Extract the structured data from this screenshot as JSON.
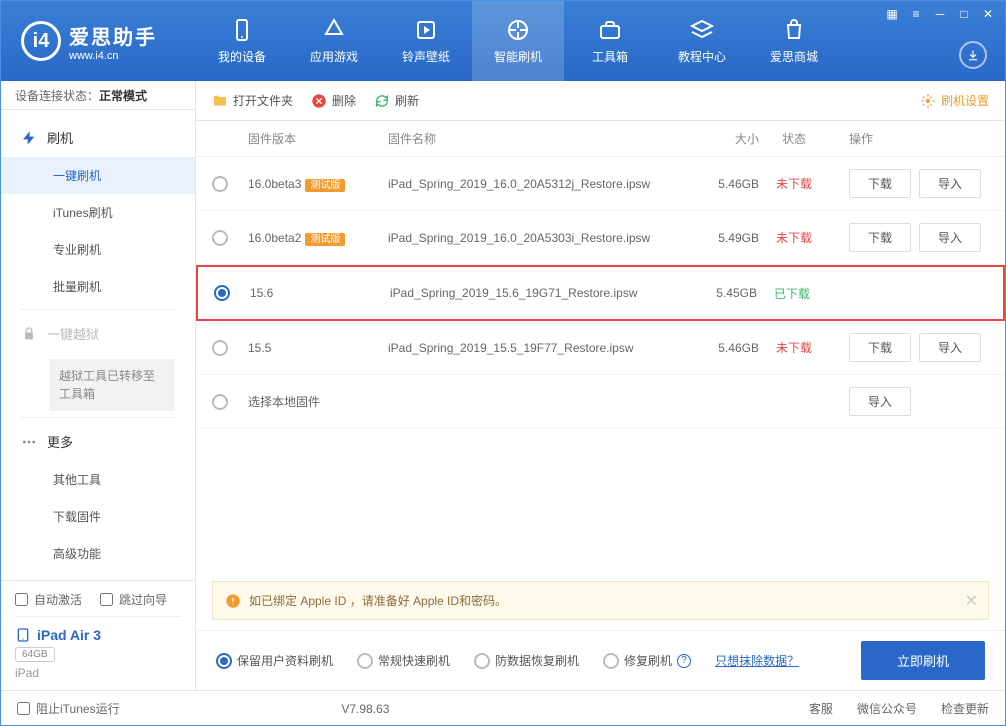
{
  "app": {
    "title": "爱思助手",
    "subtitle": "www.i4.cn"
  },
  "nav": {
    "items": [
      {
        "label": "我的设备"
      },
      {
        "label": "应用游戏"
      },
      {
        "label": "铃声壁纸"
      },
      {
        "label": "智能刷机"
      },
      {
        "label": "工具箱"
      },
      {
        "label": "教程中心"
      },
      {
        "label": "爱思商城"
      }
    ]
  },
  "status": {
    "label": "设备连接状态：",
    "value": "正常模式"
  },
  "sidebar": {
    "flash": {
      "head": "刷机",
      "items": [
        "一键刷机",
        "iTunes刷机",
        "专业刷机",
        "批量刷机"
      ]
    },
    "jailbreak": {
      "head": "一键越狱",
      "note": "越狱工具已转移至工具箱"
    },
    "more": {
      "head": "更多",
      "items": [
        "其他工具",
        "下载固件",
        "高级功能"
      ]
    },
    "auto_activate": "自动激活",
    "skip_guide": "跳过向导",
    "device": {
      "name": "iPad Air 3",
      "storage": "64GB",
      "type": "iPad"
    }
  },
  "toolbar": {
    "open": "打开文件夹",
    "delete": "删除",
    "refresh": "刷新",
    "settings": "刷机设置"
  },
  "table": {
    "head": {
      "ver": "固件版本",
      "name": "固件名称",
      "size": "大小",
      "status": "状态",
      "ops": "操作"
    },
    "download": "下载",
    "import": "导入",
    "rows": [
      {
        "ver": "16.0beta3",
        "beta": "测试版",
        "name": "iPad_Spring_2019_16.0_20A5312j_Restore.ipsw",
        "size": "5.46GB",
        "status": "未下载",
        "downloaded": false
      },
      {
        "ver": "16.0beta2",
        "beta": "测试版",
        "name": "iPad_Spring_2019_16.0_20A5303i_Restore.ipsw",
        "size": "5.49GB",
        "status": "未下载",
        "downloaded": false
      },
      {
        "ver": "15.6",
        "beta": "",
        "name": "iPad_Spring_2019_15.6_19G71_Restore.ipsw",
        "size": "5.45GB",
        "status": "已下载",
        "downloaded": true
      },
      {
        "ver": "15.5",
        "beta": "",
        "name": "iPad_Spring_2019_15.5_19F77_Restore.ipsw",
        "size": "5.46GB",
        "status": "未下载",
        "downloaded": false
      }
    ],
    "local": "选择本地固件"
  },
  "notice": "如已绑定 Apple ID ，请准备好 Apple ID和密码。",
  "options": {
    "o1": "保留用户资料刷机",
    "o2": "常规快速刷机",
    "o3": "防数据恢复刷机",
    "o4": "修复刷机",
    "erase_link": "只想抹除数据？",
    "start": "立即刷机"
  },
  "footer": {
    "block": "阻止iTunes运行",
    "version": "V7.98.63",
    "service": "客服",
    "wechat": "微信公众号",
    "update": "检查更新"
  }
}
